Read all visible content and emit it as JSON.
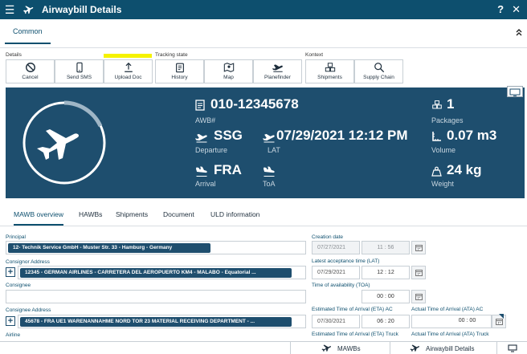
{
  "window": {
    "title": "Airwaybill Details",
    "help": "?",
    "close": "✕"
  },
  "top_tabs": {
    "common": "Common"
  },
  "toolbar": {
    "groups": {
      "details": "Details",
      "tracking": "Tracking state",
      "kontext": "Kontext"
    },
    "buttons": {
      "cancel": "Cancel",
      "send_sms": "Send SMS",
      "upload_doc": "Upload Doc",
      "history": "History",
      "map": "Map",
      "planefinder": "Planefinder",
      "shipments": "Shipments",
      "supply_chain": "Supply Chain"
    }
  },
  "banner": {
    "awb": {
      "value": "010-12345678",
      "caption": "AWB#"
    },
    "departure": {
      "value": "SSG",
      "caption": "Departure"
    },
    "lat": {
      "value": "07/29/2021 12:12 PM",
      "caption": "LAT"
    },
    "arrival": {
      "value": "FRA",
      "caption": "Arrival"
    },
    "toa": {
      "caption": "ToA"
    },
    "packages": {
      "value": "1",
      "caption": "Packages"
    },
    "volume": {
      "value": "0.07 m3",
      "caption": "Volume"
    },
    "weight": {
      "value": "24 kg",
      "caption": "Weight"
    }
  },
  "sub_tabs": [
    "MAWB overview",
    "HAWBs",
    "Shipments",
    "Document",
    "ULD information"
  ],
  "form": {
    "principal": {
      "label": "Principal",
      "value": "12- Technik Service GmbH - Muster Str. 33 - Hamburg - Germany"
    },
    "consignor": {
      "label": "Consignor Address",
      "value": "12345 - GERMAN AIRLINES - CARRETERA DEL AEROPUERTO KM4 - MALABO - Equatorial ..."
    },
    "consignee": {
      "label": "Consignee",
      "value": ""
    },
    "consignee_address": {
      "label": "Consignee Address",
      "value": "45678 - FRA UE1 WARENANNAHME NORD TOR 23 MATERIAL RECEIVING DEPARTMENT - ..."
    },
    "airline": {
      "label": "Airline"
    },
    "creation_date": {
      "label": "Creation date",
      "date": "07/27/2021",
      "hour": "11",
      "minute": "56"
    },
    "lat": {
      "label": "Latest acceptance time (LAT)",
      "date": "07/29/2021",
      "hour": "12",
      "minute": "12"
    },
    "toa": {
      "label": "Time of availability (TOA)",
      "hour": "00",
      "minute": "00"
    },
    "eta_ac": {
      "label": "Estimated Time of Arrival (ETA) AC",
      "date": "07/30/2021",
      "hour": "06",
      "minute": "20"
    },
    "ata_ac": {
      "label": "Actual Time of Arrival (ATA) AC",
      "hour": "00",
      "minute": "00"
    },
    "eta_truck": {
      "label": "Estimated Time of Arrival (ETA) Truck"
    },
    "ata_truck": {
      "label": "Actual Time of Arrival (ATA) Truck"
    }
  },
  "bottom_bar": {
    "mawbs": "MAWBs",
    "airwaybill_details": "Airwaybill Details"
  },
  "colors": {
    "primary": "#0d4f6e",
    "banner": "#1e4e6e",
    "highlight": "#f5f200"
  }
}
